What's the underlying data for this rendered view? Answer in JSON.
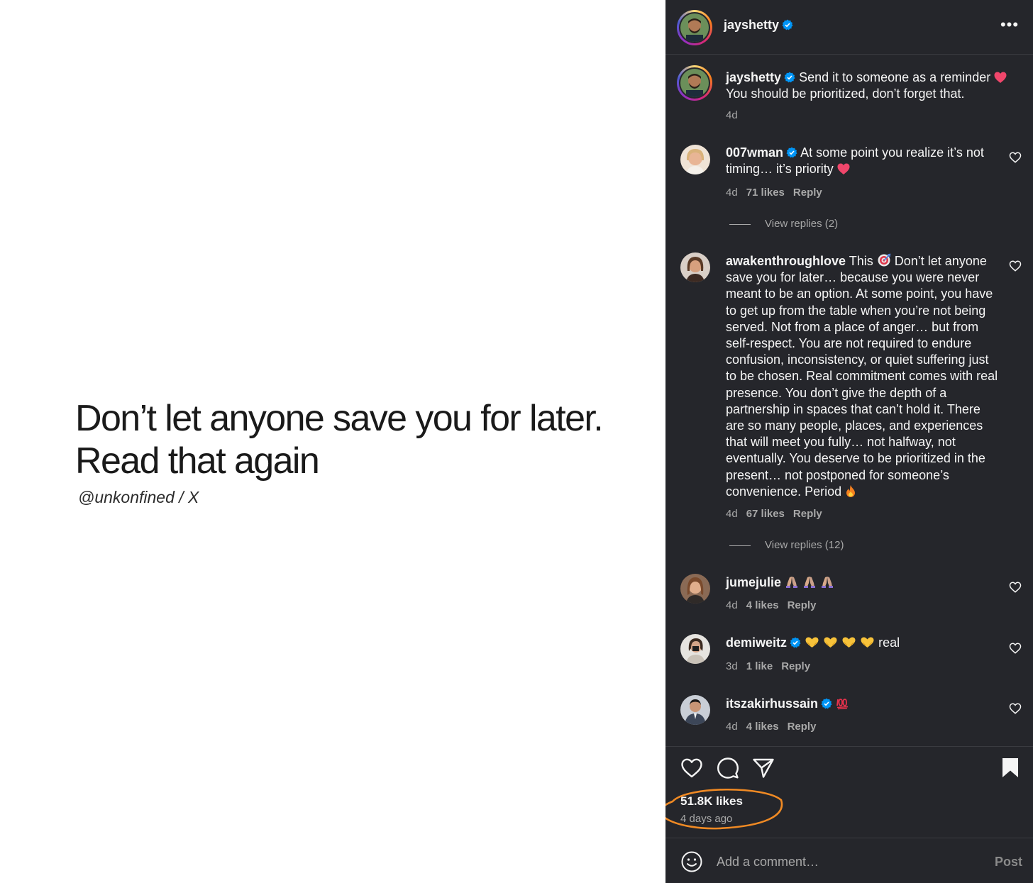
{
  "image": {
    "line1": "Don’t let anyone save you for later.",
    "line2": "Read that again",
    "credit": "@unkonfined / X"
  },
  "header": {
    "username": "jayshetty"
  },
  "caption": {
    "username": "jayshetty",
    "text_a": "Send it to someone as a reminder",
    "text_b": "You should be prioritized, don’t forget that.",
    "time": "4d"
  },
  "comments": [
    {
      "username": "007wman",
      "text_a": "At some point you realize it’s not",
      "text_b": "timing… it’s priority",
      "time": "4d",
      "likes": "71 likes",
      "reply": "Reply",
      "view_replies": "View replies (2)"
    },
    {
      "username": "awakenthroughlove",
      "text_a": "This",
      "text_b": "Don’t let anyone save you for later… because you were never meant to be an option. At some point, you have to get up from the table when you’re not being served. Not from a place of anger… but from self-respect. You are not required to endure confusion, inconsistency, or quiet suffering just to be chosen. Real commitment comes with real presence. You don’t give the depth of a partnership in spaces that can’t hold it. There are so many people, places, and experiences that will meet you fully… not halfway, not eventually. You deserve to be prioritized in the present… not postponed for someone’s convenience. Period",
      "time": "4d",
      "likes": "67 likes",
      "reply": "Reply",
      "view_replies": "View replies (12)"
    },
    {
      "username": "jumejulie",
      "text_a": "",
      "time": "4d",
      "likes": "4 likes",
      "reply": "Reply"
    },
    {
      "username": "demiweitz",
      "text_a": "real",
      "time": "3d",
      "likes": "1 like",
      "reply": "Reply"
    },
    {
      "username": "itszakirhussain",
      "text_a": "",
      "time": "4d",
      "likes": "4 likes",
      "reply": "Reply"
    }
  ],
  "footer": {
    "likes": "51.8K likes",
    "time_ago": "4 days ago",
    "comment_placeholder": "Add a comment…",
    "post_label": "Post"
  },
  "icons": {
    "more": "more-options-icon",
    "verified": "verified-badge-icon",
    "like": "heart-icon",
    "comment": "comment-bubble-icon",
    "share": "send-icon",
    "save": "bookmark-icon",
    "emoji": "emoji-smile-icon"
  },
  "colors": {
    "panel_bg": "#25262b",
    "verified": "#0095f6",
    "highlight": "#f08a24",
    "heart_emoji": "#f0466b"
  }
}
